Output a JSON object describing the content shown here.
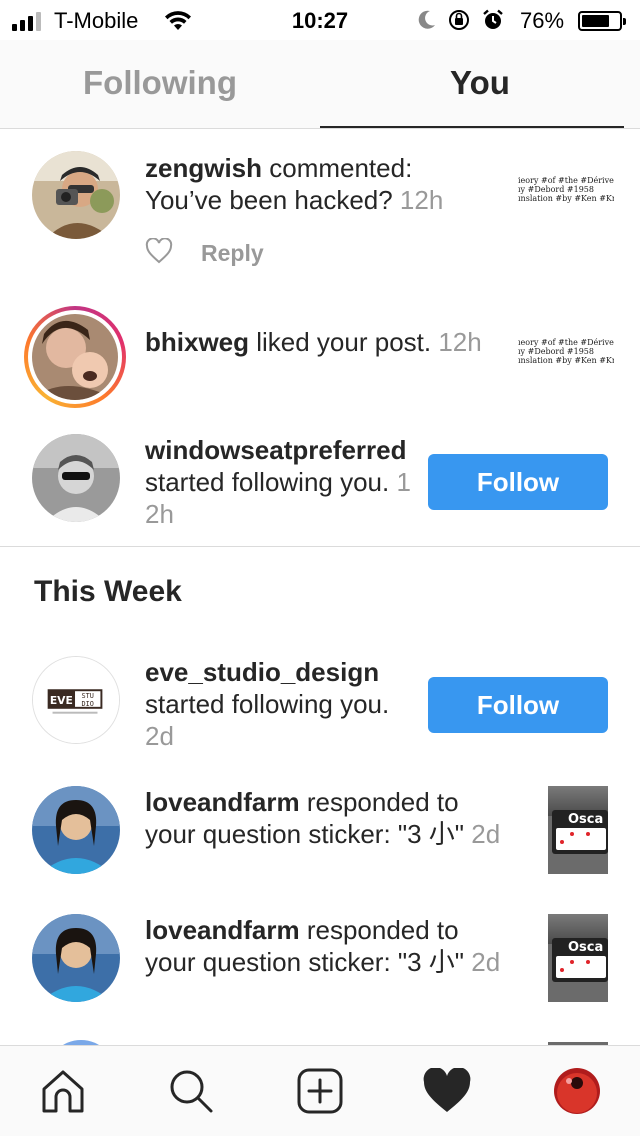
{
  "status_bar": {
    "carrier": "T-Mobile",
    "time": "10:27",
    "battery": "76%",
    "battery_level": 0.76,
    "icons": [
      "signal-icon",
      "wifi-icon",
      "moon-icon",
      "rotation-lock-icon",
      "alarm-icon",
      "battery-icon"
    ]
  },
  "tabs": [
    {
      "label": "Following",
      "active": false
    },
    {
      "label": "You",
      "active": true
    }
  ],
  "notifications": [
    {
      "user": "zengwish",
      "action": " commented: You’ve been hacked? ",
      "time": "12h",
      "reply_label": "Reply",
      "thumb_lines": [
        "ieory #of #the #Dérive",
        "ıy #Debord #1958",
        "ınslation #by #Ken #Kna"
      ]
    },
    {
      "user": "bhixweg",
      "action": " liked your post. ",
      "time": "12h",
      "thumb_lines": [
        "ıeory #of #the #Dérive",
        "ıy #Debord #1958",
        "ınslation #by #Ken #Kna"
      ]
    },
    {
      "user": "windowseatpreferred",
      "action": " started following you. ",
      "time": "12h",
      "button": "Follow"
    }
  ],
  "section_title": "This Week",
  "week_notifications": [
    {
      "user": "eve_studio_design",
      "action": " started following you. ",
      "time": "2d",
      "button": "Follow",
      "logo_text": "EVE STU DIO"
    },
    {
      "user": "loveandfarm",
      "action": " responded to your question sticker: \"3 小\" ",
      "time": "2d",
      "thumb_label": "Osca"
    },
    {
      "user": "loveandfarm",
      "action": " responded to your question sticker: \"3 小\" ",
      "time": "2d",
      "thumb_label": "Osca"
    }
  ],
  "bottom_nav": [
    "home-icon",
    "search-icon",
    "new-post-icon",
    "activity-heart-icon",
    "profile-avatar"
  ],
  "colors": {
    "accent": "#3897f0",
    "text": "#262626",
    "muted": "#999999",
    "divider": "#dbdbdb"
  }
}
